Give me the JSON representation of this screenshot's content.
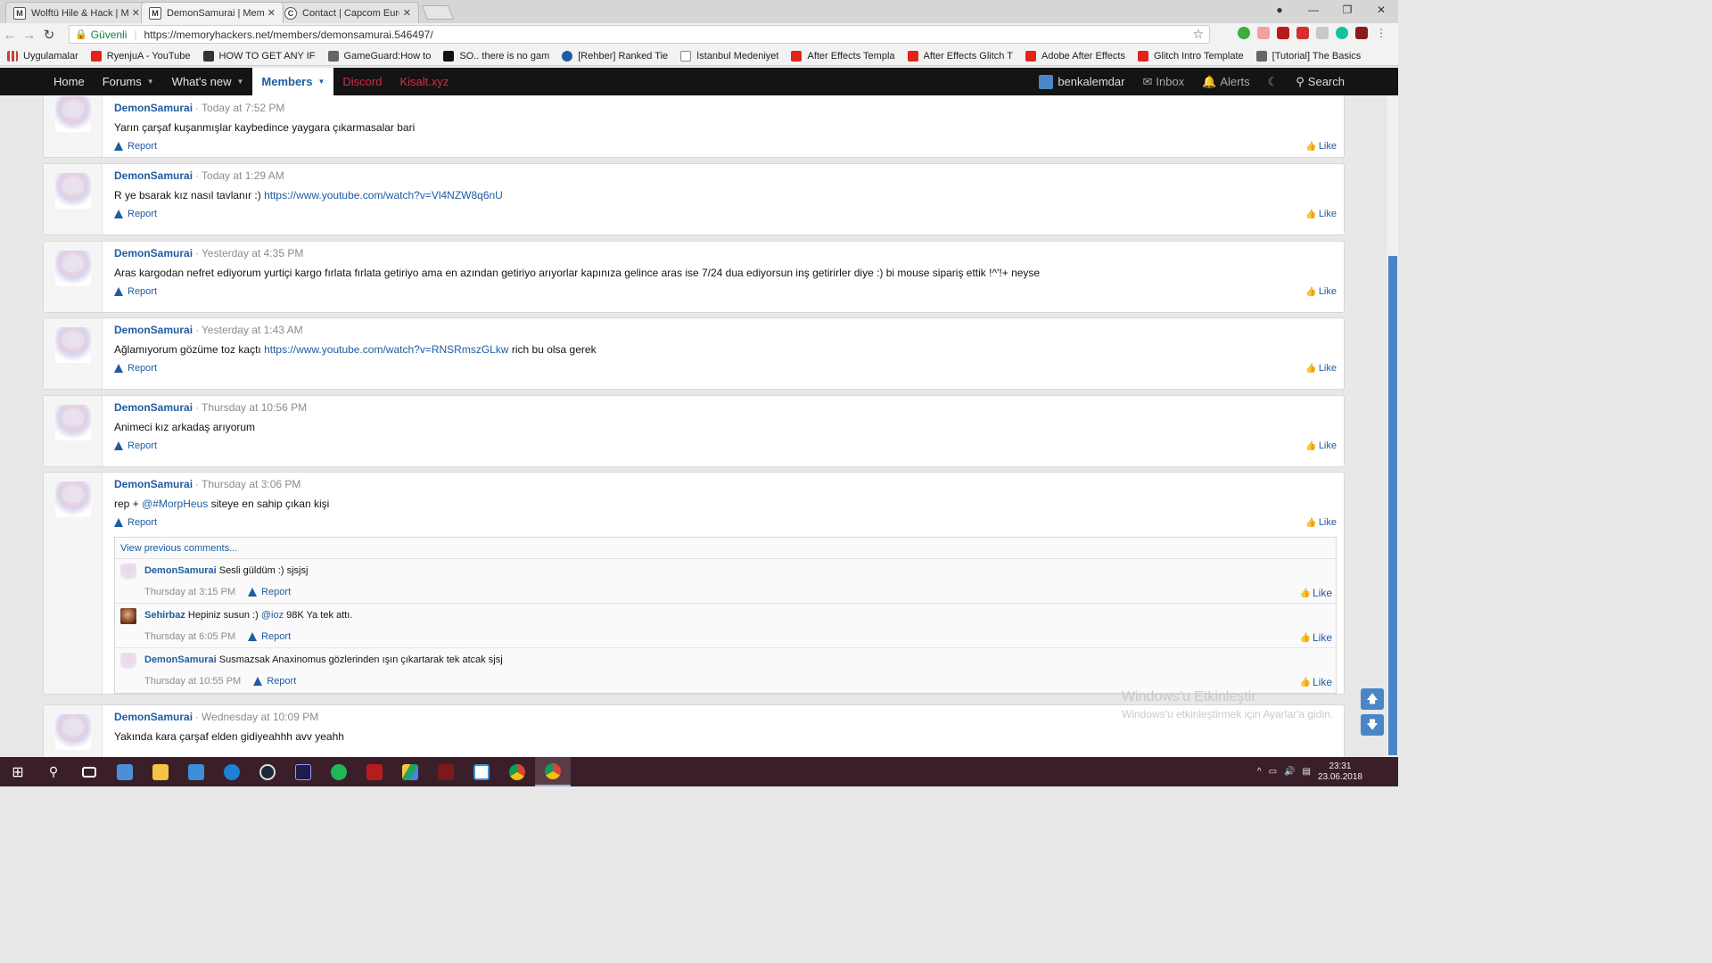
{
  "browser": {
    "tabs": [
      {
        "icon": "M",
        "title": "Wolftü Hile & Hack | Me",
        "active": false
      },
      {
        "icon": "M",
        "title": "DemonSamurai | Memory",
        "active": true
      },
      {
        "icon": "C",
        "title": "Contact | Capcom Europe",
        "active": false
      }
    ],
    "secure_label": "Güvenli",
    "url": "https://memoryhackers.net/members/demonsamurai.546497/"
  },
  "bookmarks": [
    {
      "label": "Uygulamalar",
      "color": "#d04030"
    },
    {
      "label": "RyenjuA - YouTube",
      "color": "#e62117"
    },
    {
      "label": "HOW TO GET ANY IF",
      "color": "#333333"
    },
    {
      "label": "GameGuard:How to",
      "color": "#666666"
    },
    {
      "label": "SO.. there is no gam",
      "color": "#111111"
    },
    {
      "label": "[Rehber] Ranked Tie",
      "color": "#1f5ca1"
    },
    {
      "label": "İstanbul Medeniyet",
      "color": "#ffffff"
    },
    {
      "label": "After Effects Templa",
      "color": "#e62117"
    },
    {
      "label": "After Effects Glitch T",
      "color": "#e62117"
    },
    {
      "label": "Adobe After Effects",
      "color": "#e62117"
    },
    {
      "label": "Glitch Intro Template",
      "color": "#e62117"
    },
    {
      "label": "[Tutorial] The Basics",
      "color": "#666666"
    }
  ],
  "nav": {
    "home": "Home",
    "forums": "Forums",
    "whats_new": "What's new",
    "members": "Members",
    "discord": "Discord",
    "kisalt": "Kisalt.xyz",
    "username": "benkalemdar",
    "inbox": "Inbox",
    "alerts": "Alerts",
    "search": "Search"
  },
  "labels": {
    "report": "Report",
    "like": "Like",
    "view_previous": "View previous comments..."
  },
  "posts": [
    {
      "author": "DemonSamurai",
      "time": "Today at 7:52 PM",
      "text": "Yarın çarşaf kuşanmışlar kaybedince yaygara çıkarmasalar bari",
      "link": ""
    },
    {
      "author": "DemonSamurai",
      "time": "Today at 1:29 AM",
      "text": "R ye bsarak kız nasıl tavlanır :) ",
      "link": "https://www.youtube.com/watch?v=Vl4NZW8q6nU"
    },
    {
      "author": "DemonSamurai",
      "time": "Yesterday at 4:35 PM",
      "text": "Aras kargodan nefret ediyorum yurtiçi kargo fırlata fırlata getiriyo ama en azından getiriyo arıyorlar kapınıza gelince aras ise 7/24 dua ediyorsun inş getirirler diye :) bi mouse sipariş ettik !^'!+ neyse",
      "link": ""
    },
    {
      "author": "DemonSamurai",
      "time": "Yesterday at 1:43 AM",
      "text": "Ağlamıyorum gözüme toz kaçtı ",
      "link": "https://www.youtube.com/watch?v=RNSRmszGLkw",
      "after": " rich bu olsa gerek"
    },
    {
      "author": "DemonSamurai",
      "time": "Thursday at 10:56 PM",
      "text": "Animeci kız arkadaş arıyorum",
      "link": ""
    },
    {
      "author": "DemonSamurai",
      "time": "Thursday at 3:06 PM",
      "text": "rep + ",
      "mention": "@#MorpHeus",
      "after": " siteye en sahip çıkan kişi"
    },
    {
      "author": "DemonSamurai",
      "time": "Wednesday at 10:09 PM",
      "text": "Yakında kara çarşaf elden gidiyeahhh avv yeahh",
      "link": ""
    }
  ],
  "comments": [
    {
      "author": "DemonSamurai",
      "text": "Sesli güldüm :) sjsjsj",
      "time": "Thursday at 3:15 PM"
    },
    {
      "author": "Sehirbaz",
      "text": "Hepiniz susun :) ",
      "mention": "@ioz",
      "after": " 98K Ya tek attı.",
      "time": "Thursday at 6:05 PM"
    },
    {
      "author": "DemonSamurai",
      "text": "Susmazsak Anaxinomus gözlerinden ışın çıkartarak tek atcak sjsj",
      "time": "Thursday at 10:55 PM"
    }
  ],
  "watermark": {
    "line1": "Windows'u Etkinleştir",
    "line2": "Windows'u etkinleştirmek için Ayarlar'a gidin."
  },
  "taskbar": {
    "time": "23:31",
    "date": "23.06.2018"
  }
}
